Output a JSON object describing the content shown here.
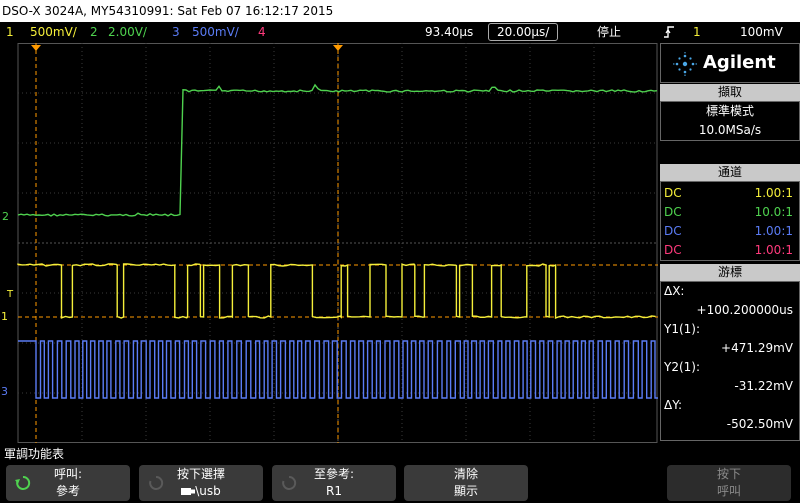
{
  "title_bar": {
    "text": "DSO-X 3024A, MY54310991: Sat Feb 07 16:12:17 2015"
  },
  "status_bar": {
    "ch1": {
      "num": "1",
      "scale": "500mV/",
      "color": "#f5ef3a"
    },
    "ch2": {
      "num": "2",
      "scale": "2.00V/",
      "color": "#4fd24f"
    },
    "ch3": {
      "num": "3",
      "scale": "500mV/",
      "color": "#5b7cf5"
    },
    "ch4": {
      "num": "4",
      "color": "#ff3a7c"
    },
    "delay": "93.40µs",
    "timebase": "20.00µs/",
    "run_state": "停止",
    "trigger": {
      "icon": "trigger-edge-icon",
      "source": "1",
      "level": "100mV"
    }
  },
  "brand": {
    "name": "Agilent"
  },
  "panel": {
    "acquire": {
      "header": "擷取",
      "mode": "標準模式",
      "rate": "10.0MSa/s"
    },
    "channels": {
      "header": "通道",
      "rows": [
        {
          "coupling": "DC",
          "probe": "1.00:1",
          "color": "#f5ef3a"
        },
        {
          "coupling": "DC",
          "probe": "10.0:1",
          "color": "#4fd24f"
        },
        {
          "coupling": "DC",
          "probe": "1.00:1",
          "color": "#5b7cf5"
        },
        {
          "coupling": "DC",
          "probe": "1.00:1",
          "color": "#ff3a7c"
        }
      ]
    },
    "cursors": {
      "header": "游標",
      "dx_label": "ΔX:",
      "dx_value": "+100.200000us",
      "y1_label": "Y1(1):",
      "y1_value": "+471.29mV",
      "y2_label": "Y2(1):",
      "y2_value": "-31.22mV",
      "dy_label": "ΔY:",
      "dy_value": "-502.50mV"
    }
  },
  "screen": {
    "ch_markers": {
      "ch1": "1",
      "ch2": "2",
      "ch3": "3",
      "trig": "T"
    },
    "traces": {
      "ch2_edges": [
        {
          "level": 0,
          "start": 0.0
        },
        {
          "level": 1,
          "start": 0.255
        }
      ],
      "ch1_edges": [
        0.0,
        0.068,
        0.085,
        0.155,
        0.165,
        0.245,
        0.265,
        0.285,
        0.29,
        0.315,
        0.335,
        0.36,
        0.395,
        0.46,
        0.505,
        0.515,
        0.55,
        0.575,
        0.6,
        0.62,
        0.635,
        0.685,
        0.69,
        0.71,
        0.74,
        0.755,
        0.795,
        0.825,
        0.83,
        0.84
      ],
      "ch3_period": 0.0135
    }
  },
  "softkeys": {
    "menu_title": "軍調功能表",
    "key1": {
      "line1": "呼叫:",
      "line2": "參考",
      "icon": "rotate-knob-icon"
    },
    "key2": {
      "line1": "按下選擇",
      "line2": "\\usb",
      "icon": "usb-drive-icon"
    },
    "key3": {
      "line1": "至參考:",
      "line2": "R1"
    },
    "key4": {
      "line1": "清除",
      "line2": "顯示"
    },
    "key5": {
      "line1": "按下",
      "line2": "呼叫"
    }
  }
}
